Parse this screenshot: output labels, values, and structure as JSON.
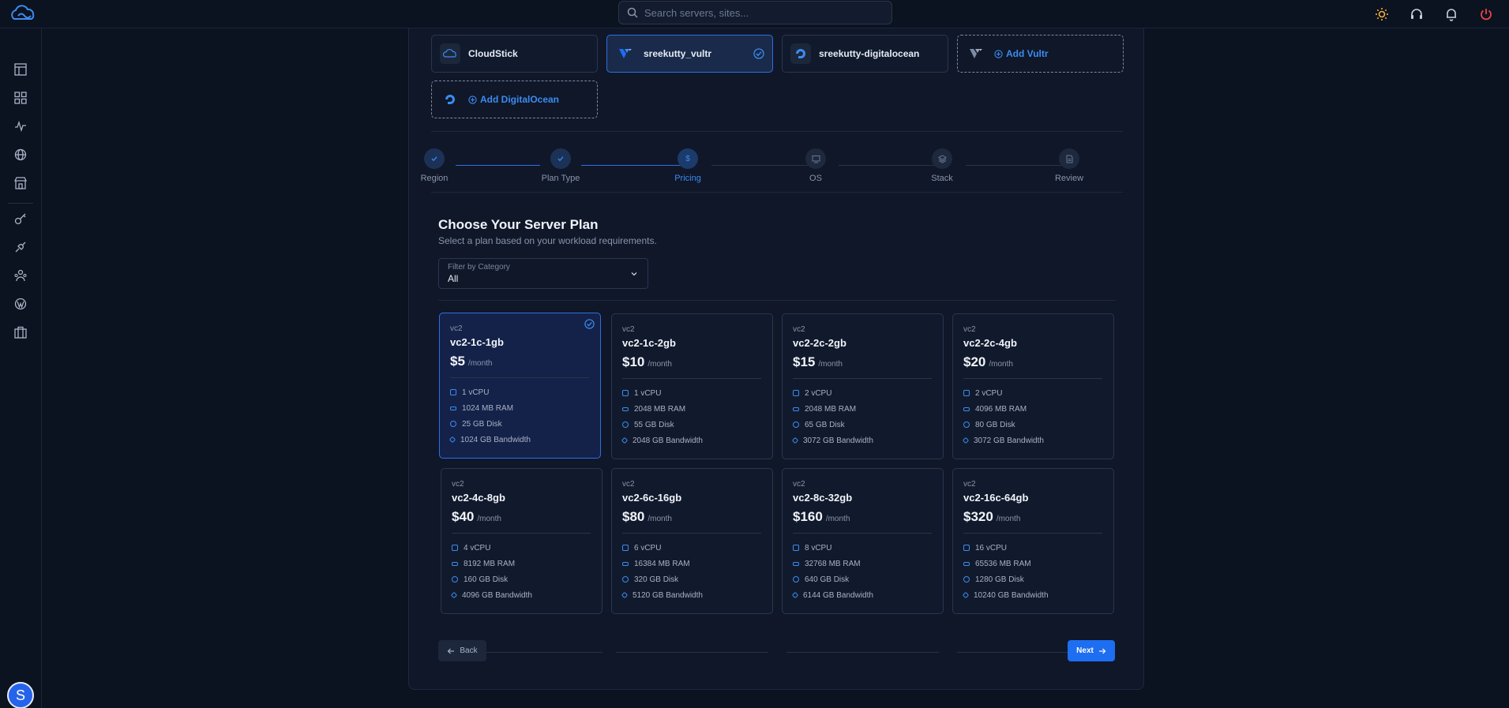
{
  "search": {
    "placeholder": "Search servers, sites..."
  },
  "colors": {
    "accent": "#2f6fe0",
    "sun": "#f5b03a",
    "power": "#ef4444"
  },
  "providers": [
    {
      "label": "CloudStick",
      "icon": "cloudstick-icon",
      "selected": false
    },
    {
      "label": "sreekutty_vultr",
      "icon": "vultr-icon",
      "selected": true
    },
    {
      "label": "sreekutty-digitalocean",
      "icon": "digitalocean-icon",
      "selected": false
    },
    {
      "label": "Add Vultr",
      "icon": "vultr-icon",
      "add": true
    },
    {
      "label": "Add DigitalOcean",
      "icon": "digitalocean-icon",
      "add": true
    }
  ],
  "steps": [
    {
      "label": "Region",
      "state": "done"
    },
    {
      "label": "Plan Type",
      "state": "done"
    },
    {
      "label": "Pricing",
      "state": "active",
      "glyph": "$"
    },
    {
      "label": "OS",
      "state": "pending"
    },
    {
      "label": "Stack",
      "state": "pending"
    },
    {
      "label": "Review",
      "state": "pending"
    }
  ],
  "section": {
    "title": "Choose Your Server Plan",
    "subtitle": "Select a plan based on your workload requirements."
  },
  "filter": {
    "label": "Filter by Category",
    "value": "All"
  },
  "plans": [
    {
      "category": "vc2",
      "name": "vc2-1c-1gb",
      "price": "$5",
      "per": "/month",
      "cpu": "1 vCPU",
      "ram": "1024 MB RAM",
      "disk": "25 GB Disk",
      "bandwidth": "1024 GB Bandwidth",
      "selected": true
    },
    {
      "category": "vc2",
      "name": "vc2-1c-2gb",
      "price": "$10",
      "per": "/month",
      "cpu": "1 vCPU",
      "ram": "2048 MB RAM",
      "disk": "55 GB Disk",
      "bandwidth": "2048 GB Bandwidth"
    },
    {
      "category": "vc2",
      "name": "vc2-2c-2gb",
      "price": "$15",
      "per": "/month",
      "cpu": "2 vCPU",
      "ram": "2048 MB RAM",
      "disk": "65 GB Disk",
      "bandwidth": "3072 GB Bandwidth"
    },
    {
      "category": "vc2",
      "name": "vc2-2c-4gb",
      "price": "$20",
      "per": "/month",
      "cpu": "2 vCPU",
      "ram": "4096 MB RAM",
      "disk": "80 GB Disk",
      "bandwidth": "3072 GB Bandwidth"
    },
    {
      "category": "vc2",
      "name": "vc2-4c-8gb",
      "price": "$40",
      "per": "/month",
      "cpu": "4 vCPU",
      "ram": "8192 MB RAM",
      "disk": "160 GB Disk",
      "bandwidth": "4096 GB Bandwidth"
    },
    {
      "category": "vc2",
      "name": "vc2-6c-16gb",
      "price": "$80",
      "per": "/month",
      "cpu": "6 vCPU",
      "ram": "16384 MB RAM",
      "disk": "320 GB Disk",
      "bandwidth": "5120 GB Bandwidth"
    },
    {
      "category": "vc2",
      "name": "vc2-8c-32gb",
      "price": "$160",
      "per": "/month",
      "cpu": "8 vCPU",
      "ram": "32768 MB RAM",
      "disk": "640 GB Disk",
      "bandwidth": "6144 GB Bandwidth"
    },
    {
      "category": "vc2",
      "name": "vc2-16c-64gb",
      "price": "$320",
      "per": "/month",
      "cpu": "16 vCPU",
      "ram": "65536 MB RAM",
      "disk": "1280 GB Disk",
      "bandwidth": "10240 GB Bandwidth"
    }
  ],
  "buttons": {
    "back": "Back",
    "next": "Next"
  },
  "user": {
    "initial": "S"
  }
}
